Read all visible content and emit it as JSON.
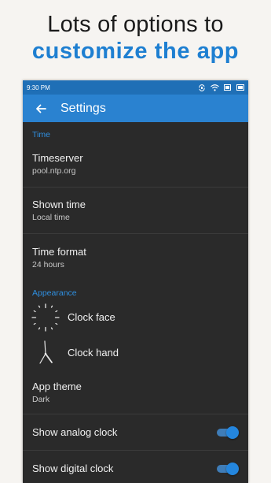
{
  "promo": {
    "line1": "Lots of options to",
    "line2": "customize the app"
  },
  "statusbar": {
    "time": "9:30 PM",
    "icons": [
      "rotation-lock-icon",
      "wifi-icon",
      "battery-icon",
      "signal-icon"
    ]
  },
  "appbar": {
    "back_icon": "arrow-left-icon",
    "title": "Settings"
  },
  "sections": {
    "time": "Time",
    "appearance": "Appearance"
  },
  "time_items": [
    {
      "title": "Timeserver",
      "value": "pool.ntp.org"
    },
    {
      "title": "Shown time",
      "value": "Local time"
    },
    {
      "title": "Time format",
      "value": "24 hours"
    }
  ],
  "appearance_items": {
    "clock_face": {
      "label": "Clock face",
      "icon": "clock-face-icon"
    },
    "clock_hand": {
      "label": "Clock hand",
      "icon": "clock-hand-icon"
    },
    "app_theme": {
      "title": "App theme",
      "value": "Dark"
    }
  },
  "toggles": [
    {
      "label": "Show analog clock",
      "on": true
    },
    {
      "label": "Show digital clock",
      "on": true
    }
  ],
  "colors": {
    "accent": "#2a82d0",
    "statusbar": "#1f6fb6",
    "section_text": "#2f8fe0",
    "promo_blue": "#1e7fd1",
    "background": "#2a2a2a"
  }
}
